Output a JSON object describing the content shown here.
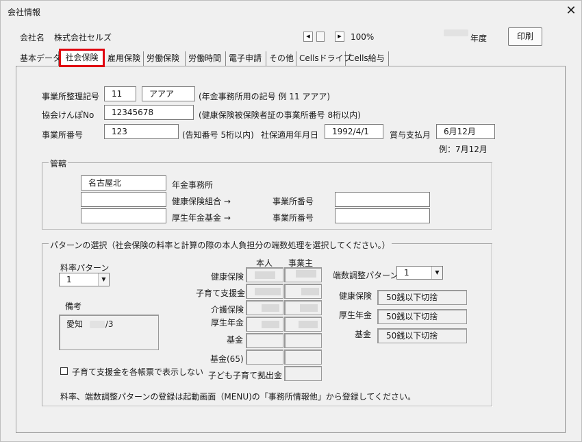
{
  "window": {
    "title": "会社情報",
    "close": "✕"
  },
  "header": {
    "company_label": "会社名",
    "company_name": "株式会社セルズ",
    "zoom": "100%",
    "year_label": "年度",
    "print_label": "印刷"
  },
  "tabs": [
    "基本データ",
    "社会保険",
    "雇用保険",
    "労働保険",
    "労働時間",
    "電子申請",
    "その他",
    "Cellsドライブ",
    "Cells給与"
  ],
  "active_tab": "社会保険",
  "form": {
    "office_code_label": "事業所整理記号",
    "office_code_num": "11",
    "office_code_kana": "アアア",
    "office_code_hint": "(年金事務所用の記号  例  11 アアア)",
    "kyokai_label": "協会けんぽNo",
    "kyokai_value": "12345678",
    "kyokai_hint": "(健康保険被保険者証の事業所番号  8桁以内)",
    "office_no_label": "事業所番号",
    "office_no_value": "123",
    "office_no_hint": "(告知番号 5桁以内)",
    "apply_date_label": "社保適用年月日",
    "apply_date_value": "1992/4/1",
    "bonus_month_label": "賞与支払月",
    "bonus_month_value": "6月12月",
    "bonus_month_example": "例：7月12月"
  },
  "kankatsu": {
    "legend": "管轄",
    "pension_office_value": "名古屋北",
    "pension_office_label": "年金事務所",
    "health_union_label": "健康保険組合 →",
    "welfare_fund_label": "厚生年金基金 →",
    "office_no_label_1": "事業所番号",
    "office_no_label_2": "事業所番号"
  },
  "pattern": {
    "legend": "パターンの選択（社会保険の料率と計算の際の本人負担分の端数処理を選択してください。）",
    "rate_label": "料率パターン",
    "rate_value": "1",
    "biko_label": "備考",
    "biko_prefix": "愛知",
    "biko_suffix": "/3",
    "col_self": "本人",
    "col_employer": "事業主",
    "rows": [
      "健康保険",
      "子育て支援金",
      "介護保険",
      "厚生年金",
      "基金",
      "基金(65)"
    ],
    "child_contrib_label": "子ども子育て拠出金",
    "rounding_label": "端数調整パターン",
    "rounding_value": "1",
    "rounding_rows": [
      {
        "label": "健康保険",
        "value": "50銭以下切捨"
      },
      {
        "label": "厚生年金",
        "value": "50銭以下切捨"
      },
      {
        "label": "基金",
        "value": "50銭以下切捨"
      }
    ],
    "checkbox_label": "子育て支援金を各帳票で表示しない",
    "footer_note": "料率、端数調整パターンの登録は起動画面（MENU)の「事務所情報他」から登録してください。"
  }
}
